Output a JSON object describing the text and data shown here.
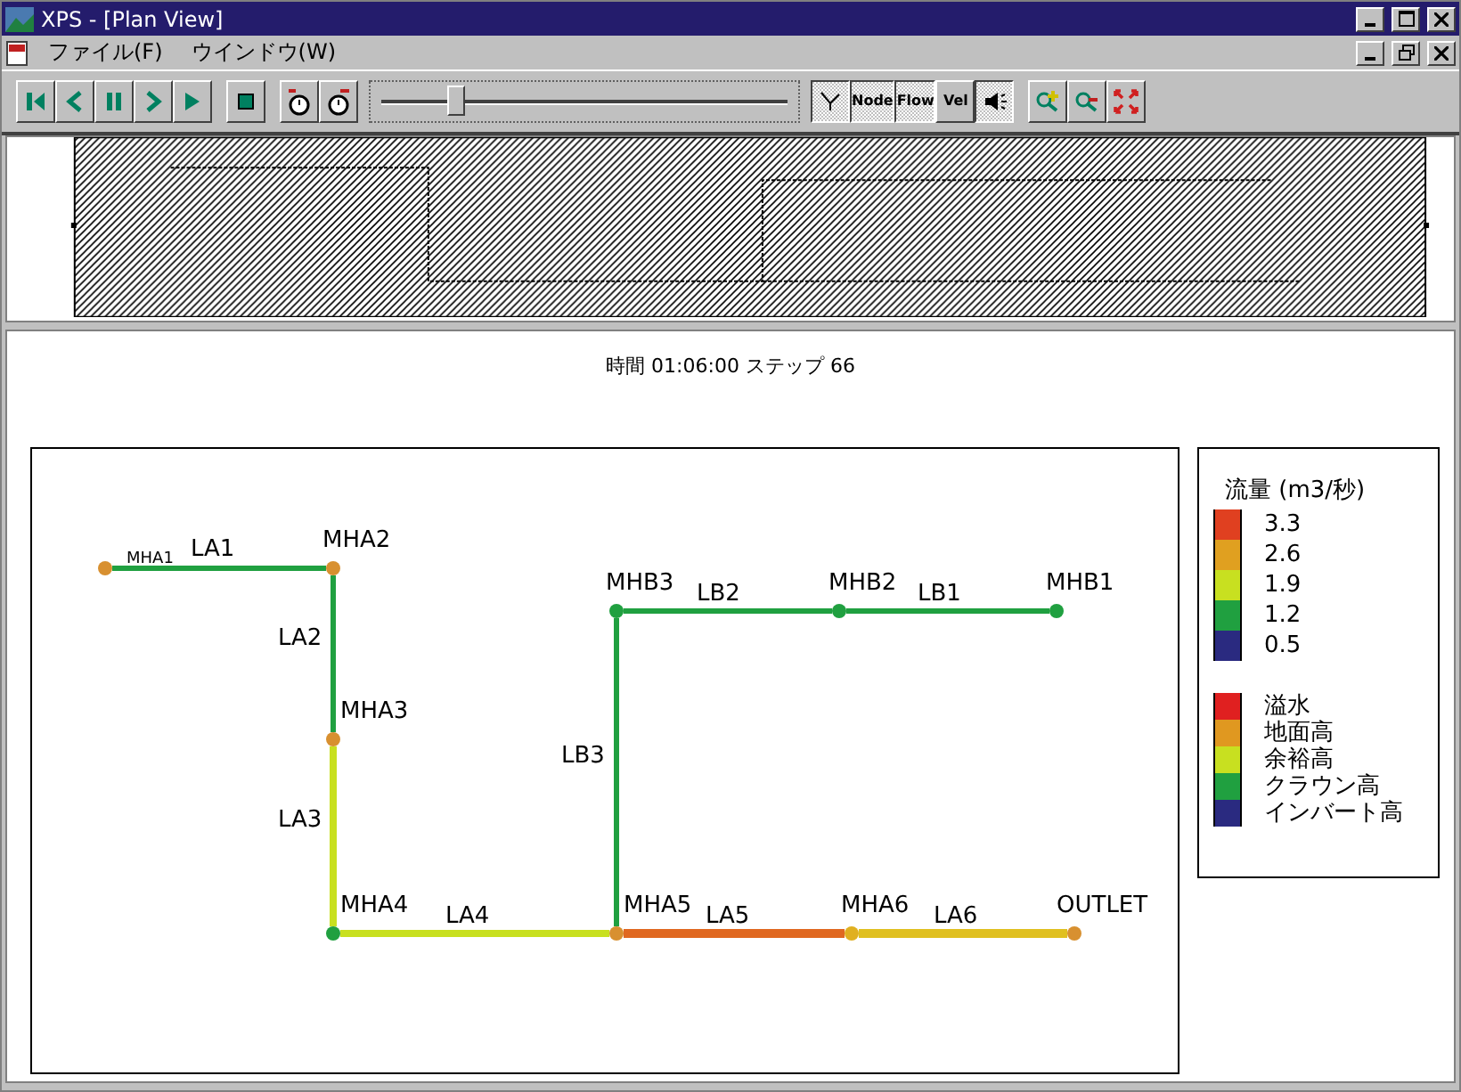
{
  "window": {
    "title": "XPS - [Plan View]"
  },
  "menu": [
    "ファイル(F)",
    "ウインドウ(W)"
  ],
  "toolbar": {
    "timeline": {
      "level": 0.19
    },
    "view_toggles": [
      {
        "kind": "cursor",
        "pressed": true
      },
      {
        "kind": "text",
        "label": "Node",
        "pressed": true
      },
      {
        "kind": "text",
        "label": "Flow",
        "pressed": true
      },
      {
        "kind": "text",
        "label": "Vel",
        "pressed": false
      },
      {
        "kind": "speaker",
        "pressed": true
      }
    ]
  },
  "plan": {
    "status": "時間 01:06:00 ステップ 66",
    "nodes": [
      {
        "label": "MHA1",
        "color": "#d89030"
      },
      {
        "label": "MHA2",
        "color": "#d89030"
      },
      {
        "label": "MHA3",
        "color": "#d89030"
      },
      {
        "label": "MHA4",
        "color": "#20a040"
      },
      {
        "label": "MHA5",
        "color": "#d89030"
      },
      {
        "label": "MHA6",
        "color": "#e0b020"
      },
      {
        "label": "OUTLET",
        "color": "#d89030"
      },
      {
        "label": "MHB3",
        "color": "#20a040"
      },
      {
        "label": "MHB2",
        "color": "#20a040"
      },
      {
        "label": "MHB1",
        "color": "#20a040"
      }
    ],
    "links": [
      {
        "label": "LA1",
        "color": "#20a040"
      },
      {
        "label": "LA2",
        "color": "#20a040"
      },
      {
        "label": "LA3",
        "color": "#c8e020"
      },
      {
        "label": "LA4",
        "color": "#c8e020"
      },
      {
        "label": "LA5",
        "color": "#e06820"
      },
      {
        "label": "LA6",
        "color": "#e0c020"
      },
      {
        "label": "LB1",
        "color": "#20a040"
      },
      {
        "label": "LB2",
        "color": "#20a040"
      },
      {
        "label": "LB3",
        "color": "#20a040"
      }
    ],
    "legend": {
      "title": "流量 (m3/秒)",
      "flow_scale": [
        {
          "value": "3.3",
          "color": "#e04020"
        },
        {
          "value": "2.6",
          "color": "#e0a020"
        },
        {
          "value": "1.9",
          "color": "#c8e020"
        },
        {
          "value": "1.2",
          "color": "#20a040"
        },
        {
          "value": "0.5",
          "color": "#2a2a80"
        }
      ],
      "node_states": [
        {
          "label": "溢水",
          "color": "#e02020"
        },
        {
          "label": "地面高",
          "color": "#e09820"
        },
        {
          "label": "余裕高",
          "color": "#c8e020"
        },
        {
          "label": "クラウン高",
          "color": "#20a040"
        },
        {
          "label": "インバート高",
          "color": "#2a2a80"
        }
      ]
    }
  }
}
